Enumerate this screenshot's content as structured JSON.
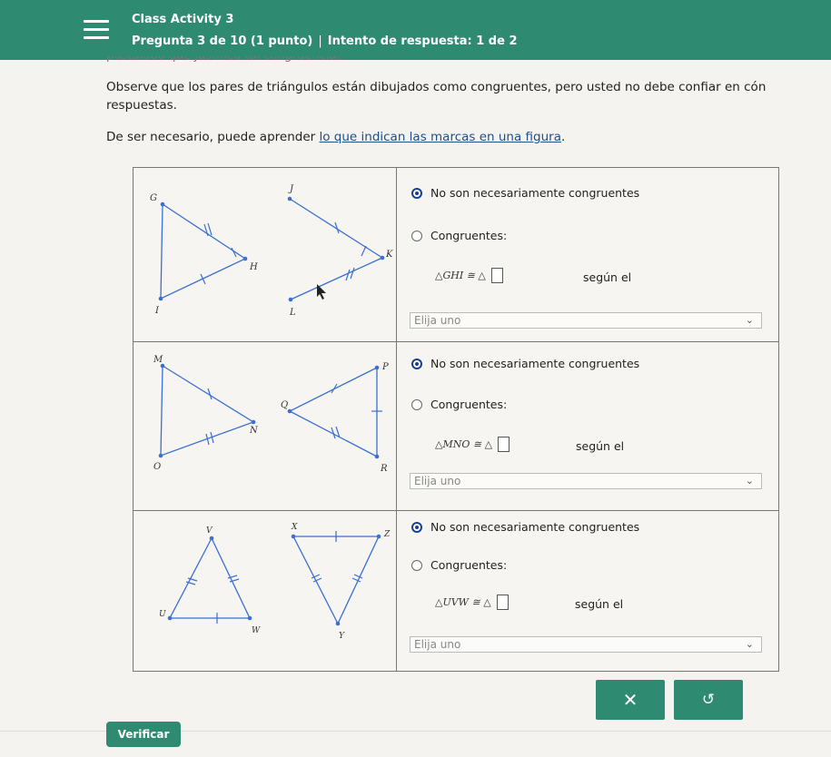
{
  "header": {
    "title": "Class Activity 3",
    "question": "Pregunta 3 de 10 (1 punto)",
    "separator": "|",
    "attempt": "Intento de respuesta: 1 de 2"
  },
  "cut_text": "postulado que justifica tal congruencia.",
  "intro": {
    "line1": "Observe que los pares de triángulos están dibujados como congruentes, pero usted no debe confiar en cón",
    "line2": "respuestas.",
    "line3_prefix": "De ser necesario, puede aprender ",
    "line3_link": "lo que indican las marcas en una figura",
    "line3_suffix": "."
  },
  "rows": [
    {
      "labels": {
        "a": "G",
        "b": "H",
        "c": "I",
        "d": "J",
        "e": "K",
        "f": "L"
      },
      "option1": "No son necesariamente congruentes",
      "option2": "Congruentes:",
      "selected": 1,
      "congruence": "△GHI ≅ △",
      "segun": "según el",
      "select_value": "Elija uno"
    },
    {
      "labels": {
        "a": "M",
        "b": "N",
        "c": "O",
        "d": "P",
        "e": "Q",
        "f": "R"
      },
      "option1": "No son necesariamente congruentes",
      "option2": "Congruentes:",
      "selected": 1,
      "congruence": "△MNO ≅ △",
      "segun": "según el",
      "select_value": "Elija uno"
    },
    {
      "labels": {
        "a": "V",
        "b": "U",
        "c": "W",
        "d": "X",
        "e": "Z",
        "f": "Y"
      },
      "option1": "No son necesariamente congruentes",
      "option2": "Congruentes:",
      "selected": 1,
      "congruence": "△UVW ≅ △",
      "segun": "según el",
      "select_value": "Elija uno"
    }
  ],
  "buttons": {
    "clear": "✕",
    "undo": "↺",
    "verify": "Verificar"
  }
}
